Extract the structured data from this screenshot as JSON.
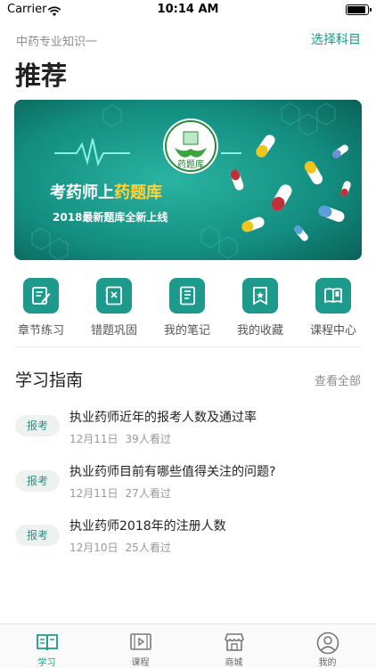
{
  "status_bar": {
    "carrier": "Carrier",
    "time": "10:14 AM"
  },
  "header": {
    "subject": "中药专业知识一",
    "choose_subject": "选择科目",
    "title": "推荐"
  },
  "banner": {
    "logo_text": "药题库",
    "headline_part1": "考药师上",
    "headline_part2": "药题库",
    "subline": "2018最新题库全新上线",
    "accent_color": "#0f8f7f"
  },
  "quick_actions": [
    {
      "label": "章节练习",
      "icon": "edit-icon"
    },
    {
      "label": "错题巩固",
      "icon": "wrong-questions-icon"
    },
    {
      "label": "我的笔记",
      "icon": "notebook-icon"
    },
    {
      "label": "我的收藏",
      "icon": "favorites-icon"
    },
    {
      "label": "课程中心",
      "icon": "course-center-icon"
    }
  ],
  "guide": {
    "title": "学习指南",
    "view_all": "查看全部",
    "items": [
      {
        "tag": "报考",
        "headline": "执业药师近年的报考人数及通过率",
        "date": "12月11日",
        "views": "39人看过"
      },
      {
        "tag": "报考",
        "headline": "执业药师目前有哪些值得关注的问题?",
        "date": "12月11日",
        "views": "27人看过"
      },
      {
        "tag": "报考",
        "headline": "执业药师2018年的注册人数",
        "date": "12月10日",
        "views": "25人看过"
      }
    ]
  },
  "tab_bar": {
    "active": "学习",
    "tabs": [
      {
        "label": "学习",
        "icon": "book-icon"
      },
      {
        "label": "课程",
        "icon": "video-icon"
      },
      {
        "label": "商城",
        "icon": "store-icon"
      },
      {
        "label": "我的",
        "icon": "profile-icon"
      }
    ]
  },
  "colors": {
    "brand": "#1a9b8e",
    "icon_bg": "#1d9a8c",
    "badge_bg": "#edf2f1"
  }
}
